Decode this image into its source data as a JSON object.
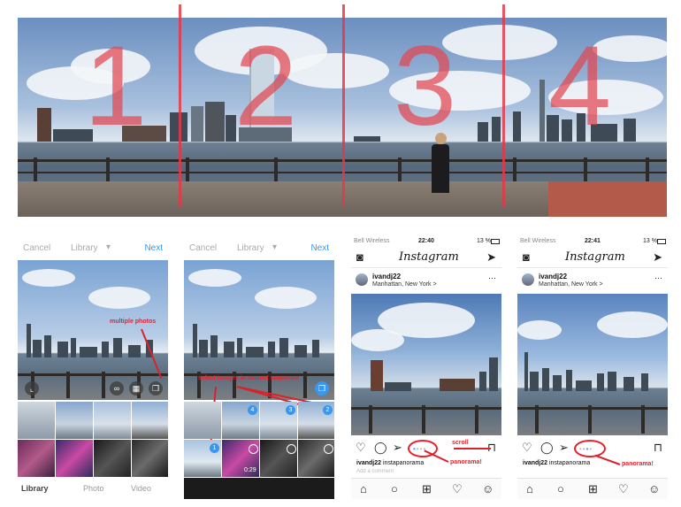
{
  "panorama": {
    "segments": [
      "1",
      "2",
      "3",
      "4"
    ]
  },
  "picker": {
    "cancel_label": "Cancel",
    "library_label": "Library",
    "next_label": "Next",
    "tabs": [
      "Library",
      "Photo",
      "Video"
    ]
  },
  "annotations": {
    "multiple_photos": "multiple photos",
    "select_sequence": "select images in correct sequence",
    "scroll": "scroll",
    "panorama": "panorama!"
  },
  "selection_badges": [
    "4",
    "3",
    "2",
    "1"
  ],
  "video_duration": "0:29",
  "feed_left": {
    "carrier": "Bell Wireless",
    "time": "22:40",
    "battery": "13 %",
    "logo": "Instagram",
    "username": "ivandj22",
    "location": "Manhattan, New York >",
    "caption_user": "ivandj22",
    "caption_text": "instapanorama",
    "comments_hint": "Add a comment"
  },
  "feed_right": {
    "carrier": "Bell Wireless",
    "time": "22:41",
    "battery": "13 %",
    "logo": "Instagram",
    "username": "ivandj22",
    "location": "Manhattan, New York >",
    "caption_user": "ivandj22",
    "caption_text": "instapanorama"
  },
  "colors": {
    "accent_red": "#e8222d",
    "instagram_blue": "#3897f0",
    "divider_red": "#e63746"
  },
  "icons": [
    "camera-icon",
    "direct-icon",
    "heart-icon",
    "comment-icon",
    "send-icon",
    "bookmark-icon",
    "home-icon",
    "search-icon",
    "add-icon",
    "activity-icon",
    "profile-icon",
    "multi-select-icon",
    "expand-icon",
    "infinity-icon",
    "layout-icon"
  ]
}
